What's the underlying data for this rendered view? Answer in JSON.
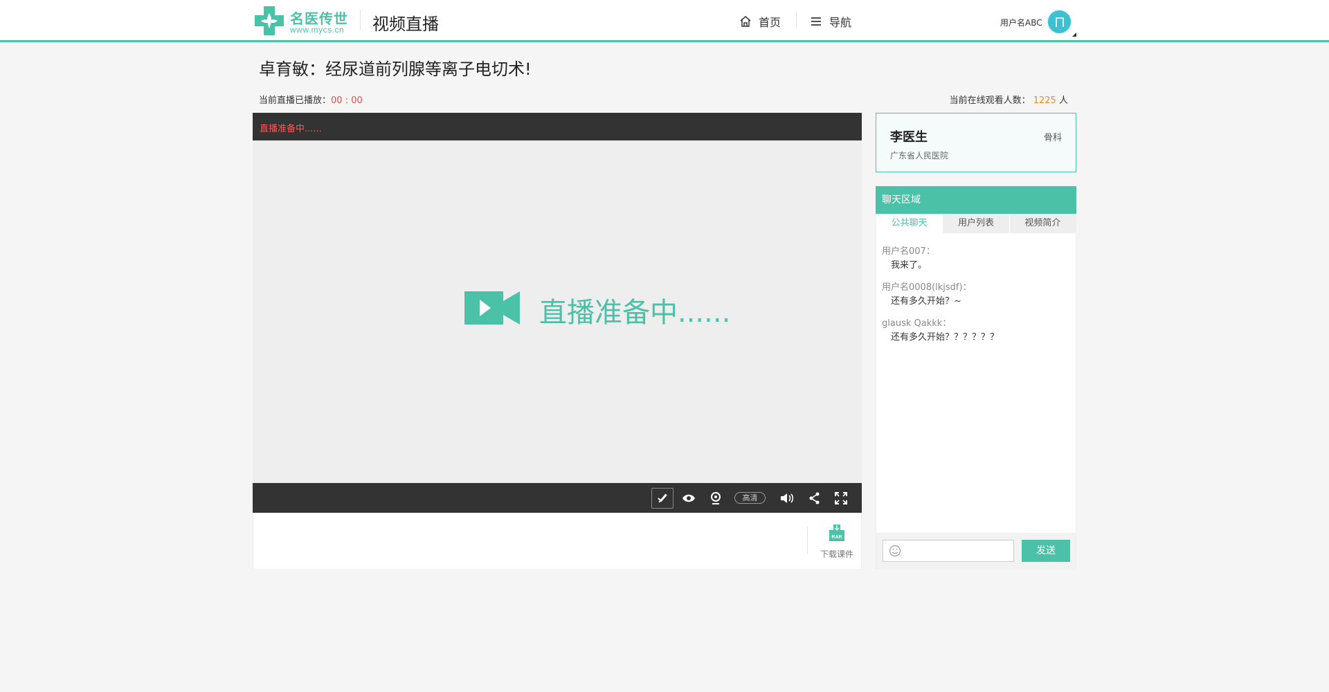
{
  "header": {
    "logo_text": "名医传世",
    "logo_url": "www.mycs.cn",
    "page_heading": "视频直播",
    "nav": {
      "home": "首页",
      "menu": "导航"
    },
    "username": "用户名ABC"
  },
  "live": {
    "title": "卓育敏：经尿道前列腺等离子电切术!",
    "played_label": "当前直播已播放：",
    "played_time": "00 : 00",
    "online_label": "当前在线观看人数：",
    "online_count": "1225",
    "online_unit": "人"
  },
  "player": {
    "status": "直播准备中......",
    "screen_message": "直播准备中......",
    "quality": "高清",
    "download_label": "下载课件",
    "download_badge": "RAR"
  },
  "doctor": {
    "name": "李医生",
    "department": "骨科",
    "hospital": "广东省人民医院"
  },
  "chat": {
    "title": "聊天区域",
    "tabs": [
      "公共聊天",
      "用户列表",
      "视频简介"
    ],
    "messages": [
      {
        "user": "用户名007：",
        "text": "我来了。"
      },
      {
        "user": "用户名0008(lkjsdf)：",
        "text": "还有多久开始？~"
      },
      {
        "user": "glausk Qakkk：",
        "text": "还有多久开始？？？？？？"
      }
    ],
    "send_label": "发送"
  },
  "colors": {
    "accent": "#4bc2a8",
    "alert": "#e84b4b",
    "count": "#f08a24",
    "avatar": "#3ec0d0"
  }
}
